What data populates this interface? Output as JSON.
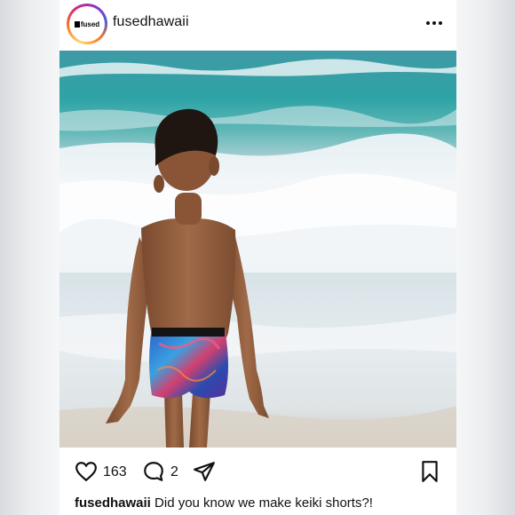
{
  "post": {
    "username": "fusedhawaii",
    "avatar_text": "fused",
    "likes": "163",
    "comments": "2",
    "caption_user": "fusedhawaii",
    "caption_text": " Did you know we make keiki shorts?!"
  },
  "icons": {
    "more": "more-horizontal-icon",
    "like": "heart-icon",
    "comment": "comment-bubble-icon",
    "share": "paper-plane-icon",
    "save": "bookmark-icon"
  }
}
